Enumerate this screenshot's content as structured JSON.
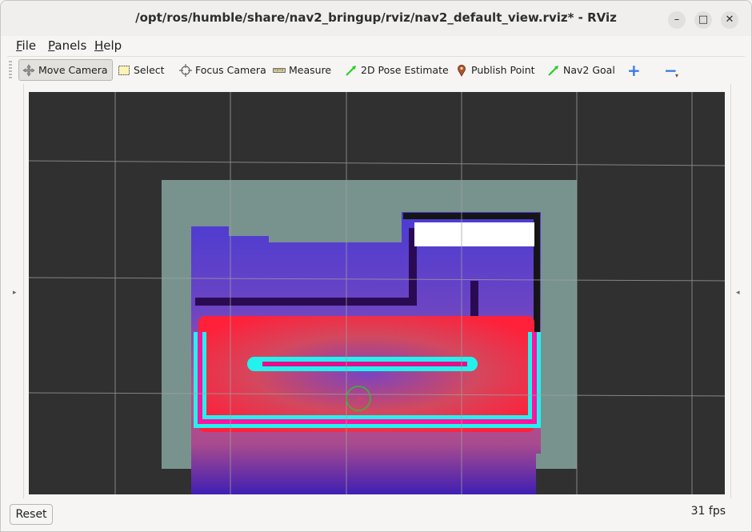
{
  "window": {
    "title": "/opt/ros/humble/share/nav2_bringup/rviz/nav2_default_view.rviz* - RViz",
    "controls": {
      "minimize": "–",
      "maximize": "□",
      "close": "✕"
    }
  },
  "menubar": {
    "items": [
      {
        "label": "File",
        "mnemonic": "F",
        "rest": "ile"
      },
      {
        "label": "Panels",
        "mnemonic": "P",
        "rest": "anels"
      },
      {
        "label": "Help",
        "mnemonic": "H",
        "rest": "elp"
      }
    ]
  },
  "toolbar": {
    "tools": [
      {
        "label": "Move Camera",
        "icon": "move-camera-icon",
        "active": true
      },
      {
        "label": "Select",
        "icon": "select-icon",
        "active": false
      },
      {
        "label": "Focus Camera",
        "icon": "focus-camera-icon",
        "active": false
      },
      {
        "label": "Measure",
        "icon": "measure-icon",
        "active": false
      },
      {
        "label": "2D Pose Estimate",
        "icon": "pose-arrow-icon",
        "active": false
      },
      {
        "label": "Publish Point",
        "icon": "map-pin-icon",
        "active": false
      },
      {
        "label": "Nav2 Goal",
        "icon": "goal-arrow-icon",
        "active": false
      }
    ],
    "add_symbol": "+",
    "remove_symbol": "−",
    "dropdown_symbol": "▾"
  },
  "colors": {
    "viewport_bg": "#303030",
    "grid": "#a0a0a0",
    "map_free": "#78938e",
    "costmap_blue": "#4b3fb8",
    "costmap_inflation": "#ff1f3d",
    "costmap_cyan": "#22f2ee",
    "robot_footprint": "#2fbf2f"
  },
  "status": {
    "reset_label": "Reset",
    "fps": "31 fps"
  },
  "side_arrows": {
    "left": "▸",
    "right": "◂"
  }
}
